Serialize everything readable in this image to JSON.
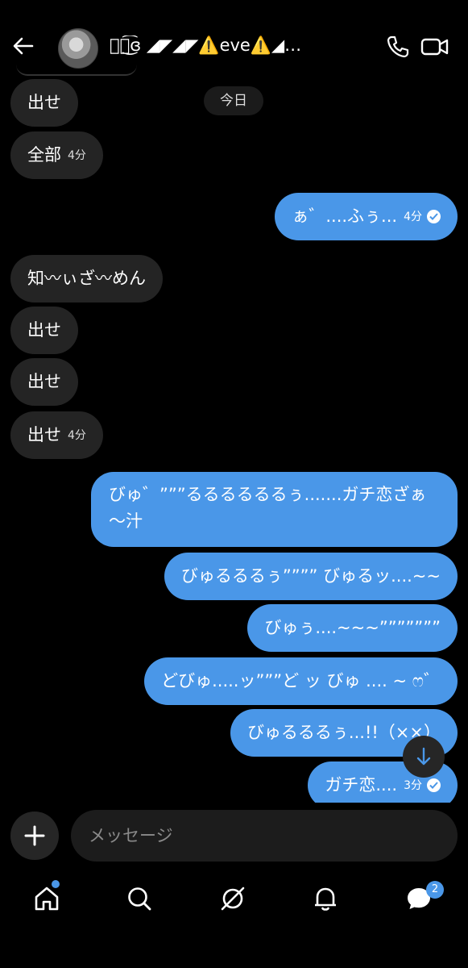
{
  "header": {
    "title": "ঔৣ͜͡ɞ ◢◤◢◤⚠️eve⚠️◢…",
    "icons": {
      "back": "arrow-left-icon",
      "call": "phone-icon",
      "video": "video-icon"
    }
  },
  "date_separator": "今日",
  "messages": [
    {
      "side": "in",
      "text": "出せ",
      "time": ""
    },
    {
      "side": "in",
      "text": "全部",
      "time": "4分"
    },
    {
      "side": "out",
      "text": "ぁ゛....ふぅ...",
      "time": "4分",
      "read": true
    },
    {
      "side": "in",
      "text": "知〰︎ぃざ〰︎めん",
      "time": ""
    },
    {
      "side": "in",
      "text": "出せ",
      "time": ""
    },
    {
      "side": "in",
      "text": "出せ",
      "time": ""
    },
    {
      "side": "in",
      "text": "出せ",
      "time": "4分"
    },
    {
      "side": "out",
      "text": "びゅ゛”””るるるるるるぅ.......ガチ恋ざぁ～汁",
      "time": ""
    },
    {
      "side": "out",
      "text": "びゅるるるぅ”””” びゅるッ....~~",
      "time": ""
    },
    {
      "side": "out",
      "text": "びゅぅ....~~~”””””””",
      "time": ""
    },
    {
      "side": "out",
      "text": "どびゅ.....ッ”””ど ッ びゅ .... ~ ෆ゛",
      "time": ""
    },
    {
      "side": "out",
      "text": "びゅるるるぅ...!!（××）",
      "time": ""
    },
    {
      "side": "out",
      "text": "ガチ恋....",
      "time": "3分",
      "read": true
    }
  ],
  "composer": {
    "placeholder": "メッセージ",
    "add_icon": "plus-icon"
  },
  "nav": {
    "items": [
      "home-icon",
      "search-icon",
      "explore-icon",
      "bell-icon",
      "messages-icon"
    ],
    "messages_badge": "2"
  },
  "colors": {
    "accent": "#4a97e8",
    "incoming_bubble": "#242424",
    "background": "#000000"
  }
}
